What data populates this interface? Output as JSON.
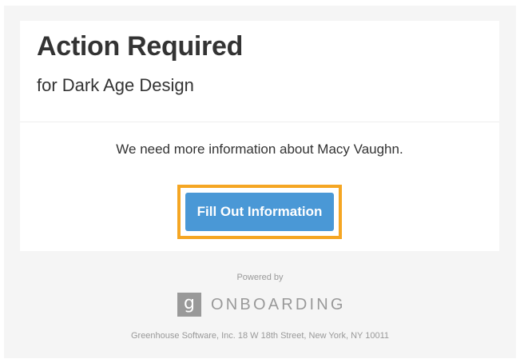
{
  "email": {
    "title": "Action Required",
    "subtitle": "for Dark Age Design",
    "message": "We need more information about Macy Vaughn.",
    "cta_label": "Fill Out Information"
  },
  "branding": {
    "powered_by": "Powered by",
    "logo_glyph": "g",
    "product_name": "ONBOARDING",
    "footer_address": "Greenhouse Software, Inc. 18 W 18th Street, New York, NY 10011"
  },
  "colors": {
    "button": "#4a98d6",
    "highlight": "#f5a623",
    "background": "#f5f5f5",
    "muted_text": "#999999"
  }
}
